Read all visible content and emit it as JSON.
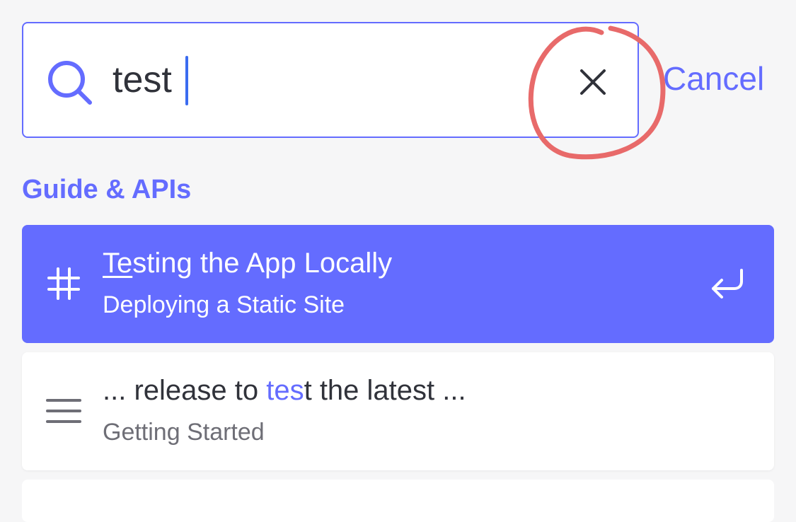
{
  "search": {
    "query": "test",
    "clear_icon": "close-icon",
    "cancel_label": "Cancel"
  },
  "section": {
    "title": "Guide & APIs"
  },
  "results": [
    {
      "title_match": "Te",
      "title_rest": "sting the App Locally",
      "subtitle": "Deploying a Static Site",
      "icon": "hash-icon",
      "action_icon": "enter-icon",
      "selected": true
    },
    {
      "title_pre": "... release to ",
      "title_match": "tes",
      "title_post": "t the latest ...",
      "subtitle": "Getting Started",
      "icon": "menu-lines-icon",
      "selected": false
    }
  ],
  "colors": {
    "accent": "#646cff",
    "background": "#f6f6f7",
    "annotation": "#e86a6a",
    "caret": "#3b6cf0"
  }
}
